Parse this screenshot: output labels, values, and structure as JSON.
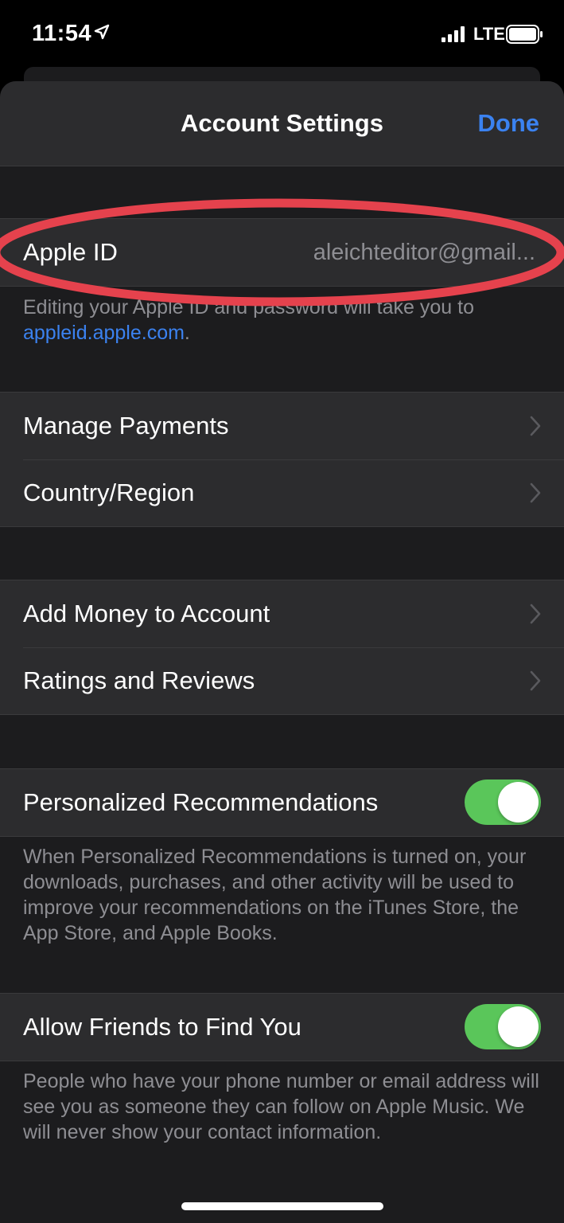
{
  "status_bar": {
    "time": "11:54",
    "carrier": "LTE",
    "icons": [
      "location-arrow-icon",
      "signal-icon",
      "battery-icon"
    ]
  },
  "nav": {
    "title": "Account Settings",
    "done_label": "Done"
  },
  "apple_id": {
    "label": "Apple ID",
    "value": "aleichteditor@gmail..."
  },
  "apple_id_footer": {
    "text": "Editing your Apple ID and password will take you to",
    "link": "appleid.apple.com",
    "suffix": "."
  },
  "group_payments": [
    {
      "label": "Manage Payments"
    },
    {
      "label": "Country/Region"
    }
  ],
  "group_money": [
    {
      "label": "Add Money to Account"
    },
    {
      "label": "Ratings and Reviews"
    }
  ],
  "personalized": {
    "label": "Personalized Recommendations",
    "enabled": true,
    "footer": "When Personalized Recommendations is turned on, your downloads, purchases, and other activity will be used to improve your recommendations on the iTunes Store, the App Store, and Apple Books."
  },
  "friends": {
    "label": "Allow Friends to Find You",
    "enabled": true,
    "footer": "People who have your phone number or email address will see you as someone they can follow on Apple Music. We will never show your contact information."
  },
  "colors": {
    "accent": "#3b82f0",
    "toggle_on": "#5ac65a",
    "annotation": "#e5424d",
    "background": "#1c1c1e",
    "cell": "#2c2c2e"
  }
}
